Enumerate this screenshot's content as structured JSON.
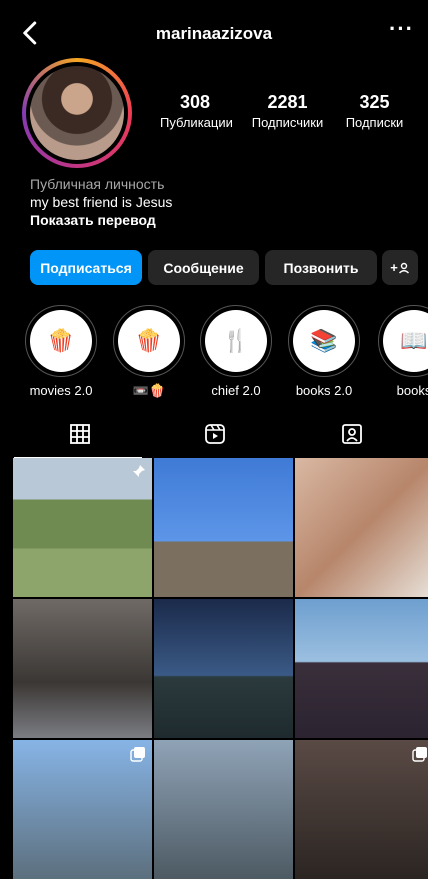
{
  "header": {
    "username": "marinaazizova",
    "more": "···"
  },
  "stats": [
    {
      "value": "308",
      "label": "Публикации"
    },
    {
      "value": "2281",
      "label": "Подписчики"
    },
    {
      "value": "325",
      "label": "Подписки"
    }
  ],
  "bio": {
    "category": "Публичная личность",
    "text": "my best friend is Jesus",
    "translate": "Показать перевод"
  },
  "buttons": {
    "follow": "Подписаться",
    "message": "Сообщение",
    "call": "Позвонить",
    "suggest": "+"
  },
  "highlights": [
    {
      "label": "movies 2.0"
    },
    {
      "label": "📼🍿"
    },
    {
      "label": "chief 2.0"
    },
    {
      "label": "books 2.0"
    },
    {
      "label": "books"
    }
  ],
  "tabs": [
    "grid",
    "reels",
    "tagged"
  ]
}
